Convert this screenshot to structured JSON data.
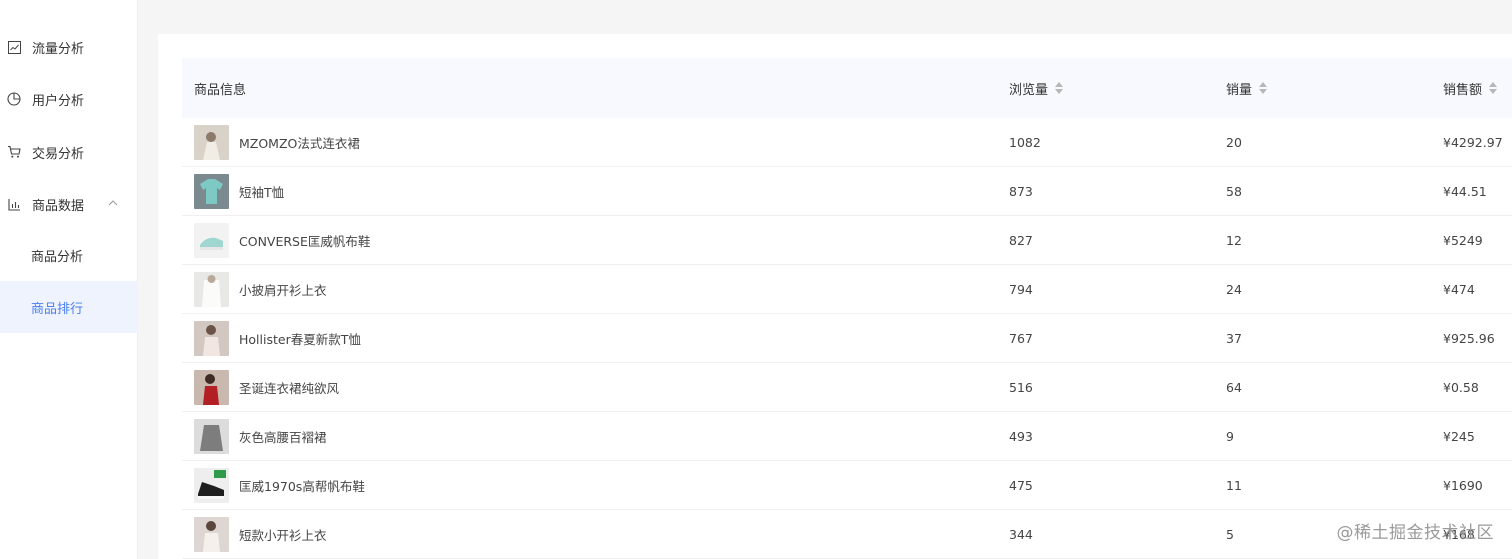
{
  "sidebar": {
    "items": [
      {
        "label": "流量分析",
        "icon": "line-chart-icon"
      },
      {
        "label": "用户分析",
        "icon": "pie-chart-icon"
      },
      {
        "label": "交易分析",
        "icon": "shopping-cart-icon"
      },
      {
        "label": "商品数据",
        "icon": "bar-chart-icon"
      }
    ],
    "submenu": [
      {
        "label": "商品分析",
        "active": false
      },
      {
        "label": "商品排行",
        "active": true
      }
    ]
  },
  "table": {
    "headers": {
      "product": "商品信息",
      "views": "浏览量",
      "sales": "销量",
      "revenue": "销售额"
    },
    "rows": [
      {
        "name": "MZOMZO法式连衣裙",
        "views": "1082",
        "sales": "20",
        "revenue": "¥4292.97"
      },
      {
        "name": "短袖T恤",
        "views": "873",
        "sales": "58",
        "revenue": "¥44.51"
      },
      {
        "name": "CONVERSE匡威帆布鞋",
        "views": "827",
        "sales": "12",
        "revenue": "¥5249"
      },
      {
        "name": "小披肩开衫上衣",
        "views": "794",
        "sales": "24",
        "revenue": "¥474"
      },
      {
        "name": "Hollister春夏新款T恤",
        "views": "767",
        "sales": "37",
        "revenue": "¥925.96"
      },
      {
        "name": "圣诞连衣裙纯欲风",
        "views": "516",
        "sales": "64",
        "revenue": "¥0.58"
      },
      {
        "name": "灰色高腰百褶裙",
        "views": "493",
        "sales": "9",
        "revenue": "¥245"
      },
      {
        "name": "匡威1970s高帮帆布鞋",
        "views": "475",
        "sales": "11",
        "revenue": "¥1690"
      },
      {
        "name": "短款小开衫上衣",
        "views": "344",
        "sales": "5",
        "revenue": "¥168"
      }
    ]
  },
  "watermark": "@稀土掘金技术社区",
  "colors": {
    "accent": "#4a7ff0",
    "active_bg": "#eef3fe",
    "header_bg": "#f7f9fe"
  }
}
